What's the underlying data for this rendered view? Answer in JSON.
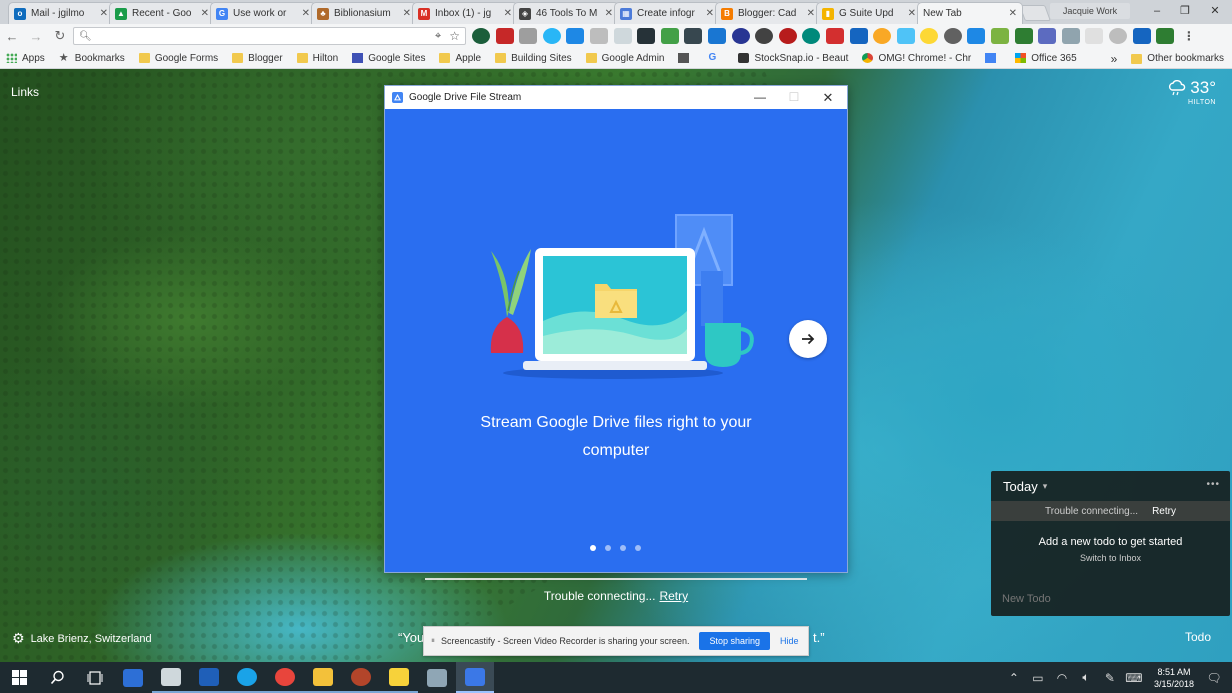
{
  "tabs": [
    {
      "title": "Mail - jgilmo",
      "color": "#0f6cbd",
      "glyph": "o"
    },
    {
      "title": "Recent - Goo",
      "color": "#1a9c4a",
      "glyph": "▲"
    },
    {
      "title": "Use work or",
      "color": "#4285f4",
      "glyph": "G"
    },
    {
      "title": "Biblionasium",
      "color": "#b06a2b",
      "glyph": "♣"
    },
    {
      "title": "Inbox (1) - jg",
      "color": "#d93025",
      "glyph": "M"
    },
    {
      "title": "46 Tools To M",
      "color": "#444",
      "glyph": "◈"
    },
    {
      "title": "Create infogr",
      "color": "#4c7bd9",
      "glyph": "▦"
    },
    {
      "title": "Blogger: Cad",
      "color": "#f57c00",
      "glyph": "B"
    },
    {
      "title": "G Suite Upd",
      "color": "#f4b400",
      "glyph": "▮"
    },
    {
      "title": "New Tab",
      "color": "",
      "glyph": ""
    }
  ],
  "profile": "Jacquie Work",
  "bookmarks": [
    {
      "label": "Apps",
      "type": "apps"
    },
    {
      "label": "Bookmarks",
      "type": "star"
    },
    {
      "label": "Google Forms",
      "type": "folder"
    },
    {
      "label": "Blogger",
      "type": "folder"
    },
    {
      "label": "Hilton",
      "type": "folder"
    },
    {
      "label": "Google Sites",
      "type": "site"
    },
    {
      "label": "Apple",
      "type": "folder"
    },
    {
      "label": "Building Sites",
      "type": "folder"
    },
    {
      "label": "Google Admin",
      "type": "folder"
    },
    {
      "label": "",
      "type": "person"
    },
    {
      "label": "",
      "type": "google"
    },
    {
      "label": "StockSnap.io - Beaut",
      "type": "camera"
    },
    {
      "label": "OMG! Chrome! - Chr",
      "type": "chrome"
    },
    {
      "label": "",
      "type": "doc"
    },
    {
      "label": "Office 365",
      "type": "office"
    }
  ],
  "bookmarks_more": "»",
  "other_bookmarks": "Other bookmarks",
  "newtab": {
    "links": "Links",
    "weather_temp": "33°",
    "weather_location": "HILTON",
    "location": "Lake Brienz, Switzerland",
    "quote_left": "“You",
    "quote_right": "t.”",
    "todo_link": "Todo"
  },
  "dfs": {
    "title": "Google Drive File Stream",
    "headline": "Stream Google Drive files right to your computer",
    "pages": 4,
    "current_page": 1
  },
  "center_trouble": {
    "text": "Trouble connecting...",
    "link": "Retry"
  },
  "todo": {
    "header": "Today",
    "trouble": "Trouble connecting...",
    "retry": "Retry",
    "empty": "Add a new todo to get started",
    "switch": "Switch to Inbox",
    "placeholder": "New Todo"
  },
  "screencastify": {
    "message": "Screencastify - Screen Video Recorder is sharing your screen.",
    "stop": "Stop sharing",
    "hide": "Hide"
  },
  "clock": {
    "time": "8:51 AM",
    "date": "3/15/2018"
  },
  "taskbar_apps": [
    {
      "name": "mail",
      "color": "#2d6fd6"
    },
    {
      "name": "cloud",
      "color": "#cfd8dc"
    },
    {
      "name": "publisher",
      "color": "#1f5fb8"
    },
    {
      "name": "skype",
      "color": "#1aa3e8"
    },
    {
      "name": "chrome",
      "color": "#e8453c"
    },
    {
      "name": "file-explorer",
      "color": "#f3c13a"
    },
    {
      "name": "chrome-canary",
      "color": "#b3452a"
    },
    {
      "name": "sticky-notes",
      "color": "#f7d23a"
    },
    {
      "name": "calculator",
      "color": "#8fa6b5"
    },
    {
      "name": "drive-file-stream",
      "color": "#3b78e7"
    }
  ]
}
